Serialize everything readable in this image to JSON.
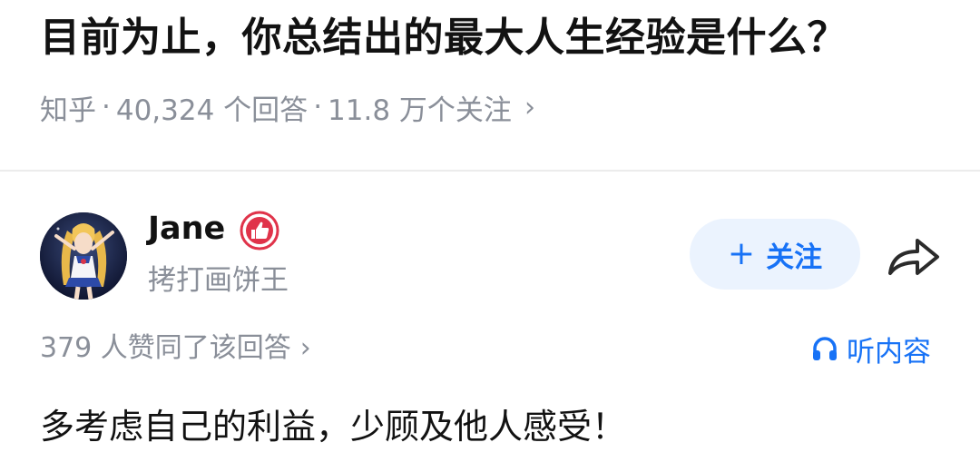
{
  "question": {
    "title": "目前为止，你总结出的最大人生经验是什么？",
    "source": "知乎",
    "answer_count": "40,324 个回答",
    "follower_count": "11.8 万个关注",
    "separator": "·",
    "more_chevron": "›"
  },
  "author": {
    "name": "Jane",
    "bio": "拷打画饼王",
    "badge_icon": "thumbs-up-badge-icon",
    "avatar_icon": "anime-avatar"
  },
  "actions": {
    "follow_plus": "+",
    "follow_label": "关注",
    "share_icon": "share-arrow-icon"
  },
  "answer": {
    "votes": "379 人赞同了该回答",
    "votes_chevron": "›",
    "listen_label": "听内容",
    "listen_icon": "headphones-icon",
    "content": "多考虑自己的利益，少顾及他人感受！"
  },
  "colors": {
    "accent": "#1772f6",
    "follow_bg": "#ebf3fe",
    "muted_text": "#8a8f99",
    "badge_red": "#e0334a"
  }
}
